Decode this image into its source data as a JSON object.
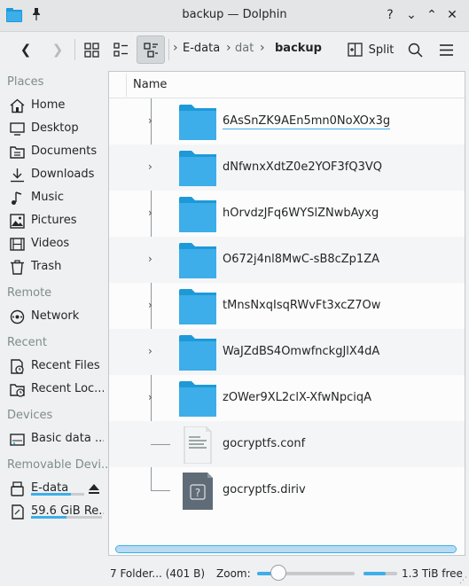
{
  "window": {
    "title": "backup — Dolphin",
    "help_glyph": "?",
    "minimize_glyph": "⌄",
    "maximize_glyph": "⌃",
    "close_glyph": "✕"
  },
  "toolbar": {
    "back_glyph": "❮",
    "forward_glyph": "❯",
    "breadcrumb": [
      "E-data",
      "dat",
      "backup"
    ],
    "split_label": "Split"
  },
  "sidebar": {
    "sections": {
      "places": "Places",
      "remote": "Remote",
      "recent": "Recent",
      "devices": "Devices",
      "removable": "Removable Devi..."
    },
    "places": [
      {
        "label": "Home",
        "icon": "home-icon"
      },
      {
        "label": "Desktop",
        "icon": "desktop-icon"
      },
      {
        "label": "Documents",
        "icon": "documents-icon"
      },
      {
        "label": "Downloads",
        "icon": "downloads-icon"
      },
      {
        "label": "Music",
        "icon": "music-icon"
      },
      {
        "label": "Pictures",
        "icon": "pictures-icon"
      },
      {
        "label": "Videos",
        "icon": "videos-icon"
      },
      {
        "label": "Trash",
        "icon": "trash-icon"
      }
    ],
    "remote": [
      {
        "label": "Network",
        "icon": "network-icon"
      }
    ],
    "recent": [
      {
        "label": "Recent Files",
        "icon": "recent-files-icon"
      },
      {
        "label": "Recent Loc...",
        "icon": "recent-locations-icon"
      }
    ],
    "devices": [
      {
        "label": "Basic data ...",
        "icon": "drive-icon"
      }
    ],
    "removable": [
      {
        "label": "E-data",
        "icon": "usb-drive-icon",
        "usage_fraction": 0.75
      },
      {
        "label": "59.6 GiB Re...",
        "icon": "sd-card-icon",
        "usage_fraction": 0.5
      }
    ]
  },
  "view": {
    "column_header": "Name",
    "items": [
      {
        "name": "6AsSnZK9AEn5mn0NoXOx3g",
        "type": "folder",
        "expander": "›",
        "editing": true
      },
      {
        "name": "dNfwnxXdtZ0e2YOF3fQ3VQ",
        "type": "folder",
        "expander": "›"
      },
      {
        "name": "hOrvdzJFq6WYSlZNwbAyxg",
        "type": "folder",
        "expander": "›"
      },
      {
        "name": "O672j4nl8MwC-sB8cZp1ZA",
        "type": "folder",
        "expander": "›"
      },
      {
        "name": "tMnsNxqIsqRWvFt3xcZ7Ow",
        "type": "folder",
        "expander": "›"
      },
      {
        "name": "WaJZdBS4OmwfnckgJlX4dA",
        "type": "folder",
        "expander": "›"
      },
      {
        "name": "zOWer9XL2clX-XfwNpciqA",
        "type": "folder",
        "expander": "›"
      },
      {
        "name": "gocryptfs.conf",
        "type": "text-file"
      },
      {
        "name": "gocryptfs.diriv",
        "type": "unknown-file"
      }
    ]
  },
  "status": {
    "info": "7 Folder... (401 B)",
    "zoom_label": "Zoom:",
    "zoom_fraction": 0.22,
    "free_space": "1.3 TiB free",
    "used_fraction": 0.65
  },
  "colors": {
    "accent": "#3daee9",
    "folder": "#3daee9",
    "folder_tab": "#1d99d8"
  }
}
